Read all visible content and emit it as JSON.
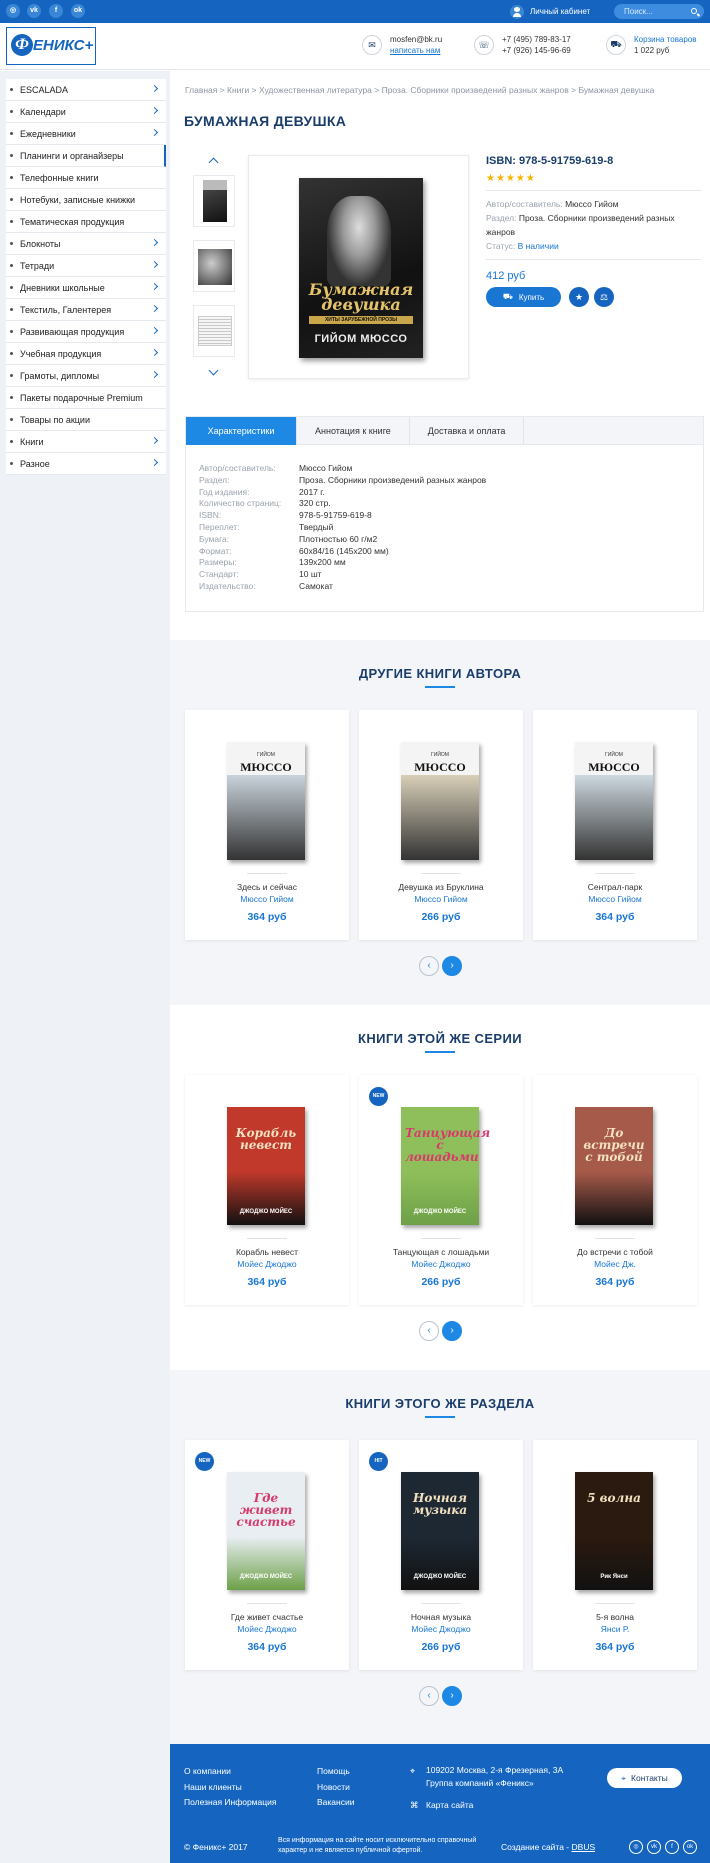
{
  "topbar": {
    "social": [
      "ig",
      "vk",
      "f",
      "ok"
    ],
    "cabinet_label": "Личный кабинет",
    "search_placeholder": "Поиск..."
  },
  "header": {
    "logo_text": "ЕНИКС+",
    "logo_letter": "Ф",
    "email": "mosfen@bk.ru",
    "write_us": "написать нам",
    "phone1": "+7 (495) 789-83-17",
    "phone2": "+7 (926) 145-96-69",
    "cart_label": "Корзина товаров",
    "cart_sum": "1 022 руб"
  },
  "sidebar": {
    "items": [
      {
        "label": "ESCALADA",
        "arrow": true
      },
      {
        "label": "Календари",
        "arrow": true
      },
      {
        "label": "Ежедневники",
        "arrow": true
      },
      {
        "label": "Планинги и органайзеры",
        "arrow": false,
        "active": true
      },
      {
        "label": "Телефонные книги",
        "arrow": false
      },
      {
        "label": "Нотебуки, записные книжки",
        "arrow": false
      },
      {
        "label": "Тематическая продукция",
        "arrow": false
      },
      {
        "label": "Блокноты",
        "arrow": true
      },
      {
        "label": "Тетради",
        "arrow": true
      },
      {
        "label": "Дневники школьные",
        "arrow": true
      },
      {
        "label": "Текстиль, Галентерея",
        "arrow": true
      },
      {
        "label": "Развивающая продукция",
        "arrow": true
      },
      {
        "label": "Учебная продукция",
        "arrow": true
      },
      {
        "label": "Грамоты, дипломы",
        "arrow": true
      },
      {
        "label": "Пакеты подарочные Premium",
        "arrow": false
      },
      {
        "label": "Товары по акции",
        "arrow": false
      },
      {
        "label": "Книги",
        "arrow": true
      },
      {
        "label": "Разное",
        "arrow": true
      }
    ]
  },
  "breadcrumb": "Главная > Книги > Художественная литература > Проза. Сборники произведений разных жанров > Бумажная девушка",
  "product": {
    "title": "БУМАЖНАЯ ДЕВУШКА",
    "isbn_title": "ISBN: 978-5-91759-619-8",
    "stars": "★★★★★",
    "author_label": "Автор/составитель:",
    "author": "Мюссо Гийом",
    "section_label": "Раздел:",
    "section": "Проза. Сборники произведений разных жанров",
    "status_label": "Статус:",
    "status": "В наличии",
    "price": "412 руб",
    "buy_label": "Купить",
    "cover": {
      "title": "Бумажная девушка",
      "subtitle": "ХИТЫ ЗАРУБЕЖНОЙ ПРОЗЫ",
      "author": "ГИЙОМ МЮССО"
    }
  },
  "tabs": {
    "labels": [
      "Характеристики",
      "Аннотация к книге",
      "Доставка и оплата"
    ],
    "specs": [
      {
        "k": "Автор/составитель:",
        "v": "Мюссо Гийом"
      },
      {
        "k": "Раздел:",
        "v": "Проза. Сборники произведений разных жанров"
      },
      {
        "k": "Год издания:",
        "v": "2017 г."
      },
      {
        "k": "Количество страниц:",
        "v": "320 стр."
      },
      {
        "k": "ISBN:",
        "v": "978-5-91759-619-8"
      },
      {
        "k": "Переплет:",
        "v": "Твердый"
      },
      {
        "k": "Бумага:",
        "v": "Плотностью 60 г/м2"
      },
      {
        "k": "Формат:",
        "v": "60х84/16 (145х200 мм)"
      },
      {
        "k": "Размеры:",
        "v": "139х200 мм"
      },
      {
        "k": "Стандарт:",
        "v": "10 шт"
      },
      {
        "k": "Издательство:",
        "v": "Самокат"
      }
    ]
  },
  "sections": [
    {
      "title": "ДРУГИЕ КНИГИ АВТОРА",
      "cards": [
        {
          "title": "Здесь и сейчас",
          "author": "Мюссо Гийом",
          "price": "364 руб",
          "badge": "",
          "cover_a1": "ГИЙОМ",
          "cover_a2": "МЮССО",
          "color": "#c9d3db"
        },
        {
          "title": "Девушка из Бруклина",
          "author": "Мюссо Гийом",
          "price": "266 руб",
          "badge": "",
          "cover_a1": "ГИЙОМ",
          "cover_a2": "МЮССО",
          "color": "#d8cfb8"
        },
        {
          "title": "Сентрал-парк",
          "author": "Мюссо Гийом",
          "price": "364 руб",
          "badge": "",
          "cover_a1": "ГИЙОМ",
          "cover_a2": "МЮССО",
          "color": "#cdd8df"
        }
      ]
    },
    {
      "title": "КНИГИ ЭТОЙ ЖЕ СЕРИИ",
      "cards": [
        {
          "title": "Корабль невест",
          "author": "Мойес Джоджо",
          "price": "364 руб",
          "badge": "",
          "cover_title": "Корабль невест",
          "cover_author": "ДЖОДЖО МОЙЕС",
          "color": "#c0392b"
        },
        {
          "title": "Танцующая с лошадьми",
          "author": "Мойес Джоджо",
          "price": "266 руб",
          "badge": "NEW",
          "cover_title": "Танцующая с лошадьми",
          "cover_author": "ДЖОДЖО МОЙЕС",
          "color": "#8fbf5a"
        },
        {
          "title": "До встречи с тобой",
          "author": "Мойес Дж.",
          "price": "364 руб",
          "badge": "",
          "cover_title": "До встречи с тобой",
          "cover_author": "",
          "color": "#a65a4a"
        }
      ]
    },
    {
      "title": "КНИГИ ЭТОГО ЖЕ РАЗДЕЛА",
      "cards": [
        {
          "title": "Где живет счастье",
          "author": "Мойес Джоджо",
          "price": "364 руб",
          "badge": "NEW",
          "cover_title": "Где живет счастье",
          "cover_author": "ДЖОДЖО МОЙЕС",
          "color": "#e8eef2"
        },
        {
          "title": "Ночная музыка",
          "author": "Мойес Джоджо",
          "price": "266 руб",
          "badge": "HIT",
          "cover_title": "Ночная музыка",
          "cover_author": "ДЖОДЖО МОЙЕС",
          "color": "#1d2833"
        },
        {
          "title": "5-я волна",
          "author": "Янси Р.",
          "price": "364 руб",
          "badge": "",
          "cover_title": "5 волна",
          "cover_author": "Рик Янси",
          "color": "#2b1a0f"
        }
      ]
    }
  ],
  "footer": {
    "col1": [
      "О компании",
      "Наши клиенты",
      "Полезная Информация"
    ],
    "col2": [
      "Помощь",
      "Новости",
      "Вакансии"
    ],
    "address1": "109202 Москва, 2-я Фрезерная, 3А",
    "address2": "Группа компаний «Феникс»",
    "map_label": "Карта сайта",
    "contacts_label": "Контакты",
    "copyright": "© Феникс+ 2017",
    "disclaimer1": "Вся информация на сайте носит исключительно справочный",
    "disclaimer2": "характер и не является публичной офертой.",
    "made_by": "Создание сайта - ",
    "made_by_link": "DBUS"
  }
}
